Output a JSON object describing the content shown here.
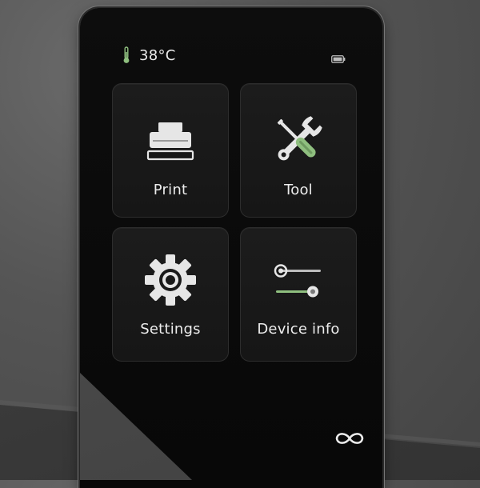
{
  "status": {
    "temperature": "38°C",
    "thermometer_icon": "thermometer-icon",
    "battery_icon": "battery-icon"
  },
  "menu": {
    "tiles": [
      {
        "label": "Print",
        "icon": "printer-icon"
      },
      {
        "label": "Tool",
        "icon": "wrench-screwdriver-icon"
      },
      {
        "label": "Settings",
        "icon": "gear-icon"
      },
      {
        "label": "Device info",
        "icon": "sliders-icon"
      }
    ]
  },
  "brand": {
    "logo_icon": "infinity-logo-icon"
  },
  "colors": {
    "accent_green": "#8fbf7f",
    "text": "#ececec",
    "tile_bg": "#1a1a1a",
    "screen_bg": "#0a0a0a"
  }
}
